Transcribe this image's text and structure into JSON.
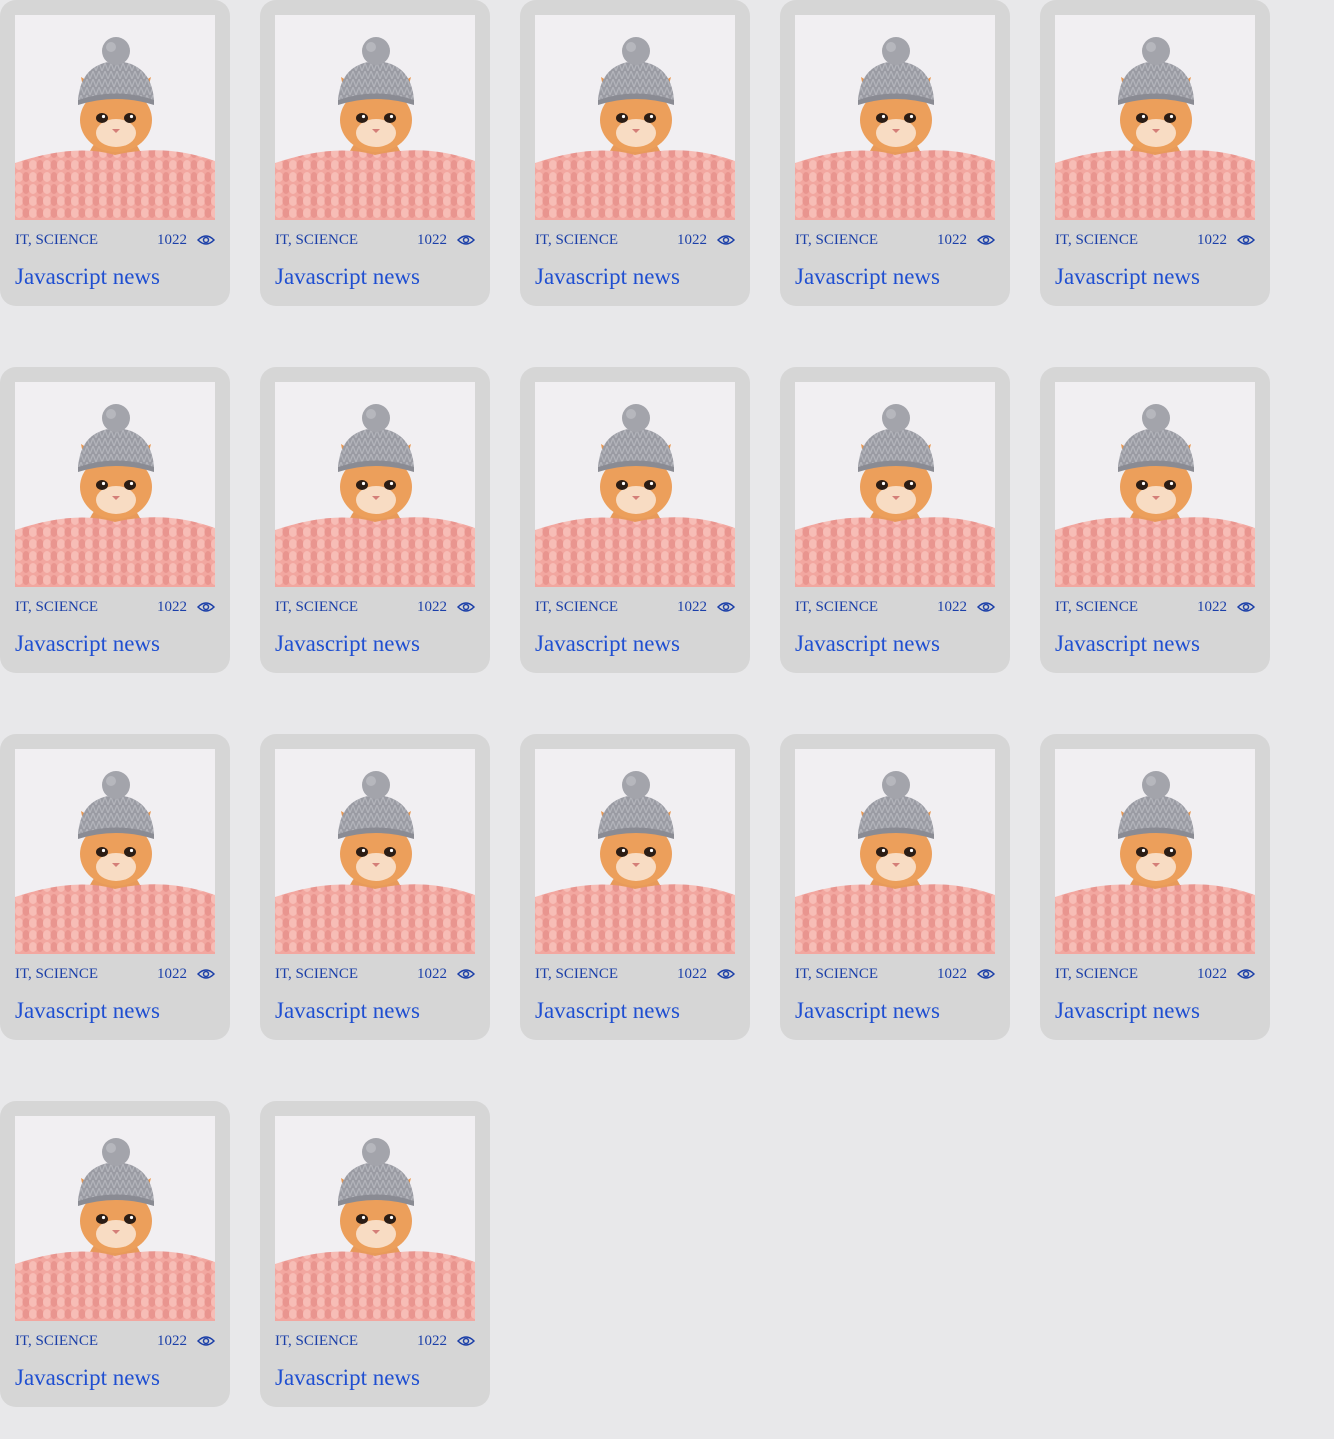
{
  "cards": [
    {
      "category": "IT, SCIENCE",
      "views": "1022",
      "title": "Javascript news",
      "image_alt": "kitten in a gray knit hat"
    },
    {
      "category": "IT, SCIENCE",
      "views": "1022",
      "title": "Javascript news",
      "image_alt": "kitten in a gray knit hat"
    },
    {
      "category": "IT, SCIENCE",
      "views": "1022",
      "title": "Javascript news",
      "image_alt": "kitten in a gray knit hat"
    },
    {
      "category": "IT, SCIENCE",
      "views": "1022",
      "title": "Javascript news",
      "image_alt": "kitten in a gray knit hat"
    },
    {
      "category": "IT, SCIENCE",
      "views": "1022",
      "title": "Javascript news",
      "image_alt": "kitten in a gray knit hat"
    },
    {
      "category": "IT, SCIENCE",
      "views": "1022",
      "title": "Javascript news",
      "image_alt": "kitten in a gray knit hat"
    },
    {
      "category": "IT, SCIENCE",
      "views": "1022",
      "title": "Javascript news",
      "image_alt": "kitten in a gray knit hat"
    },
    {
      "category": "IT, SCIENCE",
      "views": "1022",
      "title": "Javascript news",
      "image_alt": "kitten in a gray knit hat"
    },
    {
      "category": "IT, SCIENCE",
      "views": "1022",
      "title": "Javascript news",
      "image_alt": "kitten in a gray knit hat"
    },
    {
      "category": "IT, SCIENCE",
      "views": "1022",
      "title": "Javascript news",
      "image_alt": "kitten in a gray knit hat"
    },
    {
      "category": "IT, SCIENCE",
      "views": "1022",
      "title": "Javascript news",
      "image_alt": "kitten in a gray knit hat"
    },
    {
      "category": "IT, SCIENCE",
      "views": "1022",
      "title": "Javascript news",
      "image_alt": "kitten in a gray knit hat"
    },
    {
      "category": "IT, SCIENCE",
      "views": "1022",
      "title": "Javascript news",
      "image_alt": "kitten in a gray knit hat"
    },
    {
      "category": "IT, SCIENCE",
      "views": "1022",
      "title": "Javascript news",
      "image_alt": "kitten in a gray knit hat"
    },
    {
      "category": "IT, SCIENCE",
      "views": "1022",
      "title": "Javascript news",
      "image_alt": "kitten in a gray knit hat"
    },
    {
      "category": "IT, SCIENCE",
      "views": "1022",
      "title": "Javascript news",
      "image_alt": "kitten in a gray knit hat"
    },
    {
      "category": "IT, SCIENCE",
      "views": "1022",
      "title": "Javascript news",
      "image_alt": "kitten in a gray knit hat"
    }
  ],
  "icons": {
    "views": "eye-icon"
  },
  "colors": {
    "background": "#e8e8ea",
    "card": "#d6d6d6",
    "meta_text": "#1b3fa8",
    "title_text": "#1f4fd1"
  }
}
